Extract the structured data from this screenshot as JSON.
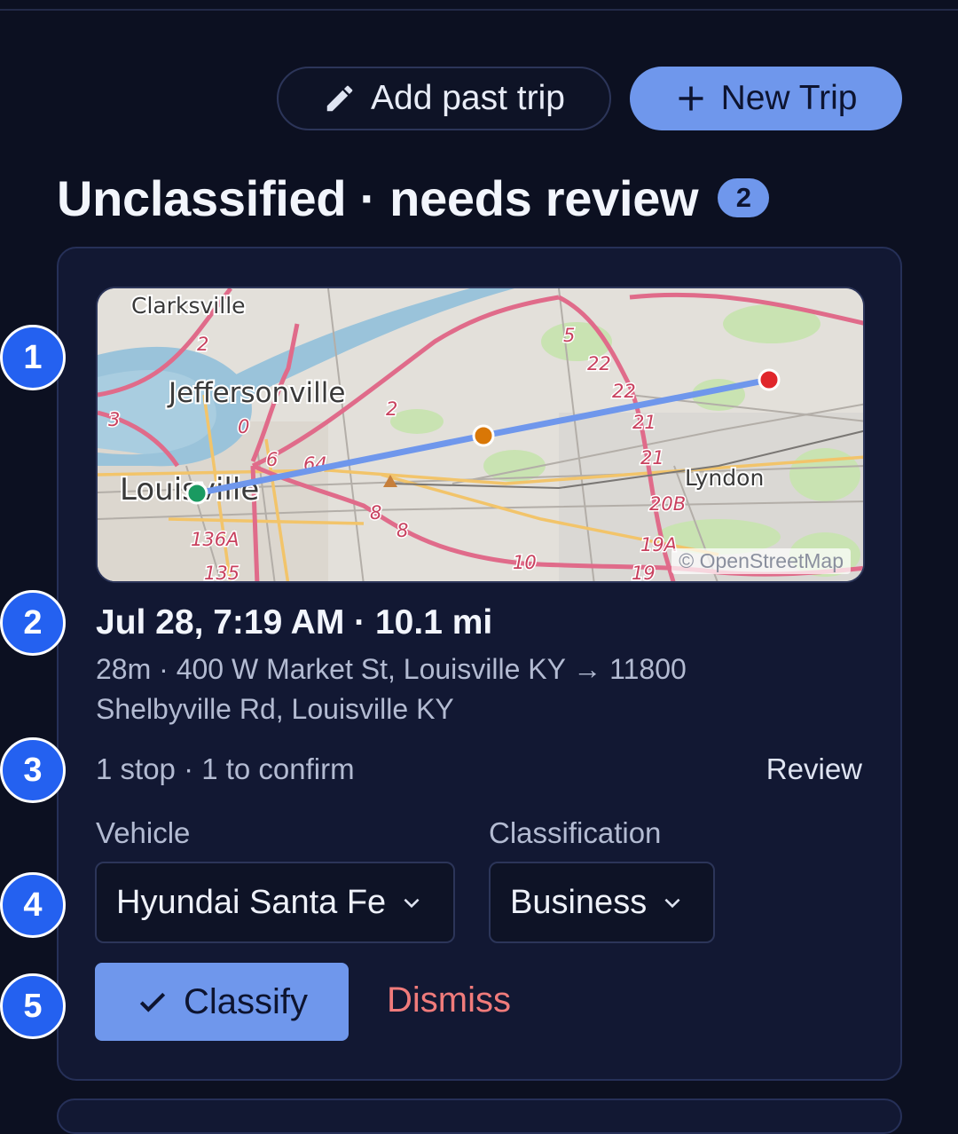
{
  "header": {
    "add_past_trip_label": "Add past trip",
    "new_trip_label": "New Trip",
    "section_title": "Unclassified · needs review",
    "section_count": "2"
  },
  "trip": {
    "map": {
      "labels": [
        "Clarksville",
        "Jeffersonville",
        "Louisville",
        "Lyndon"
      ],
      "route_numbers": [
        "2",
        "5",
        "22",
        "22",
        "2",
        "3",
        "0",
        "6",
        "64",
        "21",
        "21",
        "20B",
        "8",
        "8",
        "136A",
        "135",
        "10",
        "19A",
        "19"
      ],
      "attribution": "© OpenStreetMap",
      "route_color": "#6f97ec",
      "start_color": "#1a9a61",
      "stop_color": "#d97706",
      "end_color": "#e0262b"
    },
    "title": "Jul 28, 7:19 AM · 10.1 mi",
    "detail": "28m · 400 W Market St, Louisville KY → 11800 Shelbyville Rd, Louisville KY",
    "stops_summary": "1 stop · 1 to confirm",
    "review_label": "Review",
    "vehicle_label": "Vehicle",
    "vehicle_value": "Hyundai Santa Fe",
    "classification_label": "Classification",
    "classification_value": "Business",
    "classify_label": "Classify",
    "dismiss_label": "Dismiss"
  },
  "markers": [
    "1",
    "2",
    "3",
    "4",
    "5"
  ],
  "colors": {
    "background": "#0c1021",
    "card": "#121833",
    "accent": "#6f97ec",
    "danger": "#f07b7b"
  }
}
